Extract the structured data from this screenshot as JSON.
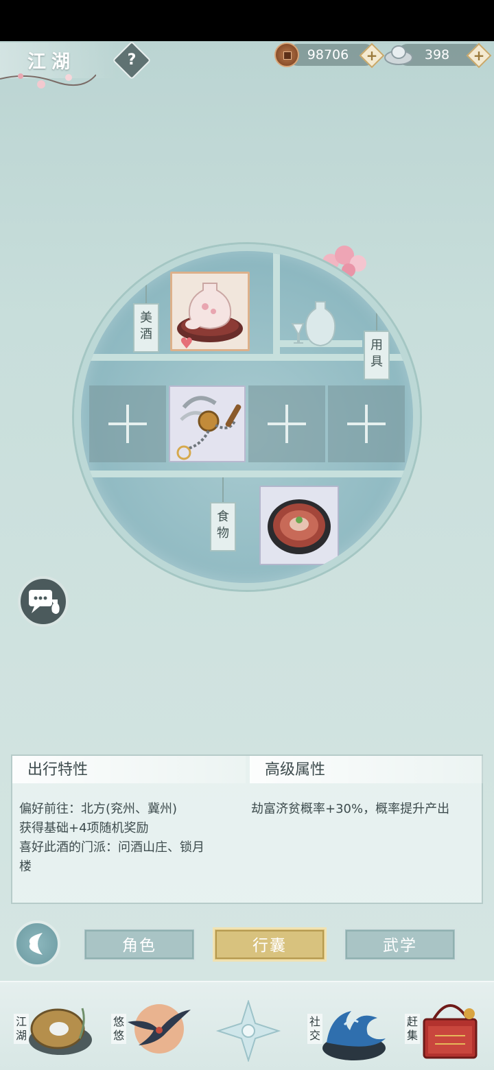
{
  "header": {
    "title": "江湖",
    "help_label": "?",
    "copper": "98706",
    "silver": "398",
    "plus": "+"
  },
  "bag": {
    "tags": {
      "wine": "美酒",
      "tools": "用具",
      "food": "食物"
    },
    "slots": [
      {
        "state": "empty",
        "symbol": "+"
      },
      {
        "state": "filled",
        "item": "meteor-hammer"
      },
      {
        "state": "empty",
        "symbol": "+"
      },
      {
        "state": "empty",
        "symbol": "+"
      }
    ]
  },
  "info": {
    "travel_title": "出行特性",
    "travel_lines": [
      "偏好前往：北方(兖州、冀州)",
      "获得基础+4项随机奖励",
      "喜好此酒的门派：问酒山庄、锁月",
      "楼"
    ],
    "advanced_title": "高级属性",
    "advanced_lines": [
      "劫富济贫概率+30%，概率提升产出"
    ]
  },
  "tabs": [
    {
      "label": "角色",
      "active": false
    },
    {
      "label": "行囊",
      "active": true
    },
    {
      "label": "武学",
      "active": false
    }
  ],
  "nav": [
    {
      "label": "江湖",
      "icon": "jianghu-icon"
    },
    {
      "label": "悠悠",
      "icon": "swallow-icon"
    },
    {
      "label": "",
      "icon": "star-compass-icon"
    },
    {
      "label": "社交",
      "icon": "wave-icon"
    },
    {
      "label": "赶集",
      "icon": "market-basket-icon"
    }
  ],
  "colors": {
    "accent_gold": "#d8c27e",
    "tab_inactive": "#a9c4c5",
    "background": "#c8dedb"
  }
}
